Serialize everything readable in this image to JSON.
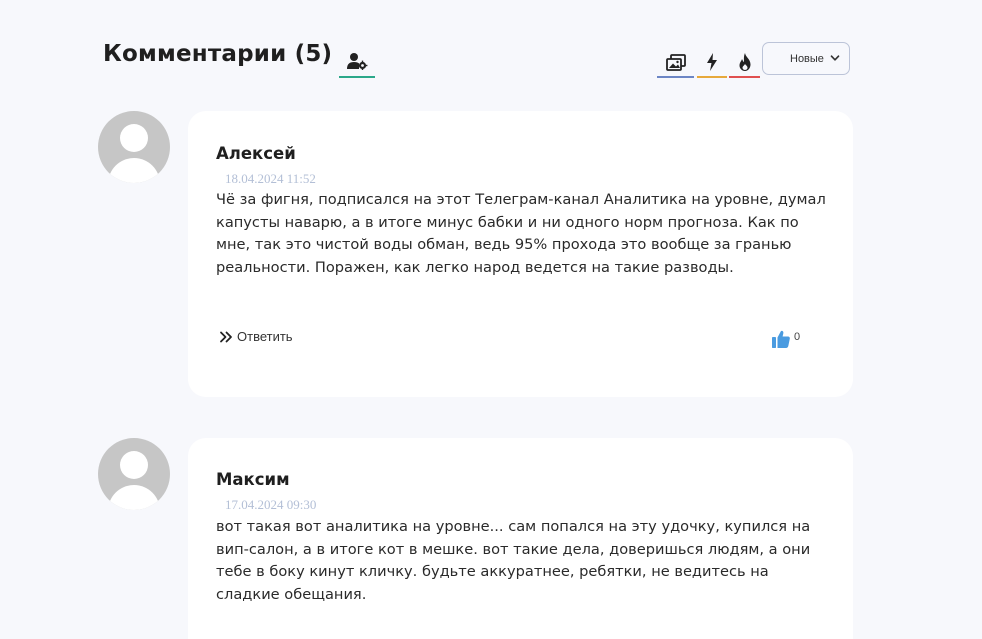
{
  "header": {
    "title": "Комментарии (5)",
    "icons": {
      "subscribe": "user-settings-icon",
      "media": "images-icon",
      "flash": "lightning-icon",
      "fire": "fire-icon"
    },
    "sort": {
      "selected": "Новые"
    }
  },
  "comments": [
    {
      "author": "Алексей",
      "date": "18.04.2024 11:52",
      "text": "Чё за фигня, подписался на этот Телеграм-канал Аналитика на уровне, думал капусты наварю, а в итоге минус бабки и ни одного норм прогноза. Как по мне, так это чистой воды обман, ведь 95% прохода это вообще за гранью реальности. Поражен, как легко народ ведется на такие разводы.",
      "reply_label": "Ответить",
      "likes": "0"
    },
    {
      "author": "Максим",
      "date": "17.04.2024 09:30",
      "text": "вот такая вот аналитика на уровне... сам попался на эту удочку, купился на вип-салон, а в итоге кот в мешке. вот такие дела, доверишься людям, а они тебе в боку кинут кличку. будьте аккуратнее, ребятки, не ведитесь на сладкие обещания."
    }
  ],
  "colors": {
    "background": "#f7f8fc",
    "card": "#ffffff",
    "date": "#b3bfd6",
    "like": "#4a9be0",
    "subscribe_underline": "#2ba88a",
    "media_underline": "#6c86c5",
    "flash_underline": "#e7a93b",
    "fire_underline": "#e05050"
  }
}
